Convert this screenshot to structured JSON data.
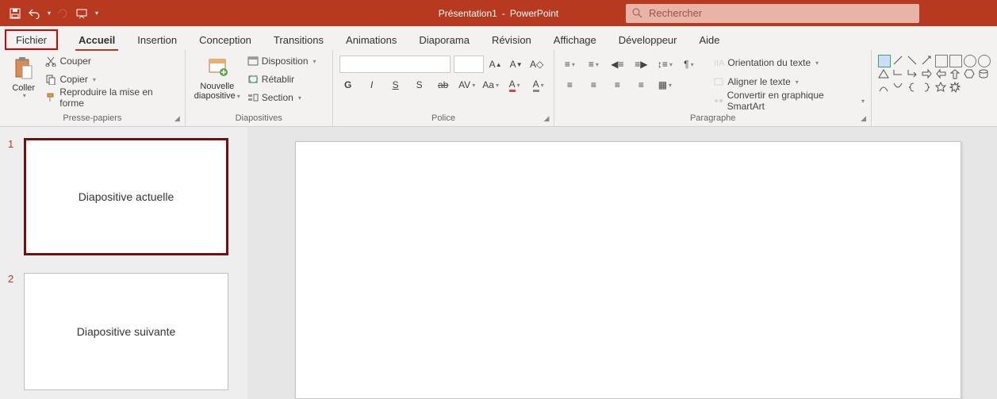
{
  "app": {
    "doc": "Présentation1",
    "product": "PowerPoint",
    "sep": " - ",
    "search_placeholder": "Rechercher"
  },
  "tabs": {
    "file": "Fichier",
    "home": "Accueil",
    "insert": "Insertion",
    "design": "Conception",
    "transitions": "Transitions",
    "animations": "Animations",
    "slideshow": "Diaporama",
    "review": "Révision",
    "view": "Affichage",
    "developer": "Développeur",
    "help": "Aide"
  },
  "groups": {
    "clipboard": {
      "label": "Presse-papiers",
      "paste": "Coller",
      "cut": "Couper",
      "copy": "Copier",
      "format_painter": "Reproduire la mise en forme"
    },
    "slides": {
      "label": "Diapositives",
      "new_slide1": "Nouvelle",
      "new_slide2": "diapositive",
      "layout": "Disposition",
      "reset": "Rétablir",
      "section": "Section"
    },
    "font": {
      "label": "Police"
    },
    "paragraph": {
      "label": "Paragraphe",
      "text_dir": "Orientation du texte",
      "align_text": "Aligner le texte",
      "smartart": "Convertir en graphique SmartArt"
    }
  },
  "slides_panel": {
    "items": [
      {
        "num": "1",
        "label": "Diapositive actuelle",
        "selected": true
      },
      {
        "num": "2",
        "label": "Diapositive suivante",
        "selected": false
      }
    ]
  }
}
